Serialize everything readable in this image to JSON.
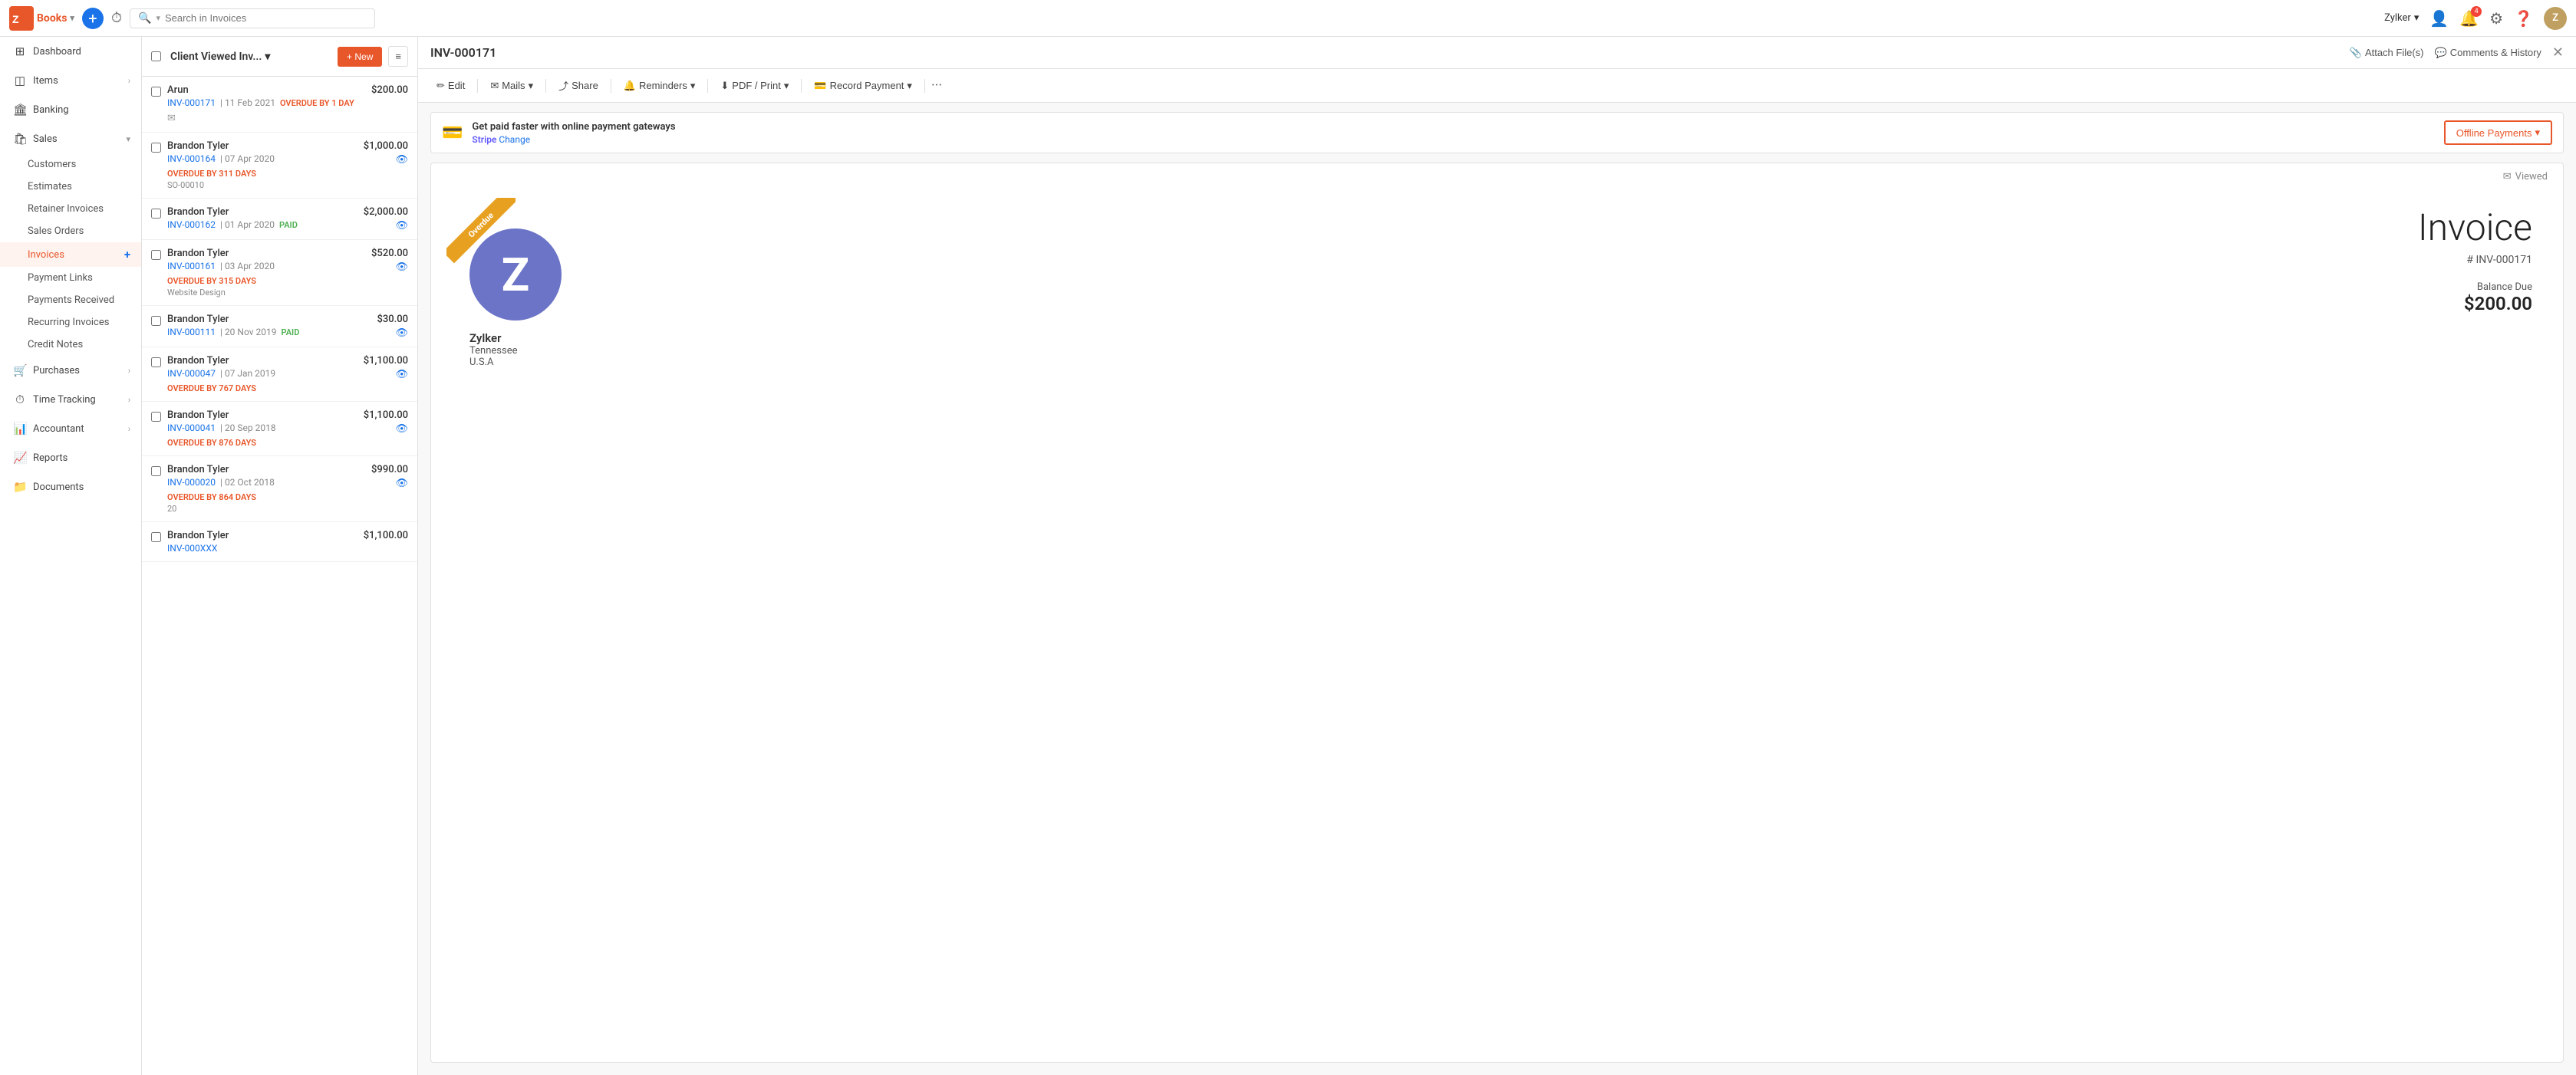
{
  "app": {
    "logo_text": "Books",
    "logo_dropdown": "▾"
  },
  "topnav": {
    "search_placeholder": "Search in Invoices",
    "user_name": "Zylker",
    "user_dropdown": "▾",
    "notification_count": "4"
  },
  "sidebar": {
    "items": [
      {
        "id": "dashboard",
        "label": "Dashboard",
        "icon": "⊞",
        "has_arrow": false
      },
      {
        "id": "items",
        "label": "Items",
        "icon": "◫",
        "has_arrow": true
      },
      {
        "id": "banking",
        "label": "Banking",
        "icon": "🏦",
        "has_arrow": false
      }
    ],
    "sales": {
      "label": "Sales",
      "sub_items": [
        {
          "id": "customers",
          "label": "Customers"
        },
        {
          "id": "estimates",
          "label": "Estimates"
        },
        {
          "id": "retainer-invoices",
          "label": "Retainer Invoices"
        },
        {
          "id": "sales-orders",
          "label": "Sales Orders"
        },
        {
          "id": "invoices",
          "label": "Invoices",
          "active": true,
          "has_plus": true
        },
        {
          "id": "payment-links",
          "label": "Payment Links"
        },
        {
          "id": "payments-received",
          "label": "Payments Received"
        },
        {
          "id": "recurring-invoices",
          "label": "Recurring Invoices"
        },
        {
          "id": "credit-notes",
          "label": "Credit Notes"
        }
      ]
    },
    "other_items": [
      {
        "id": "purchases",
        "label": "Purchases",
        "icon": "🛒",
        "has_arrow": true
      },
      {
        "id": "time-tracking",
        "label": "Time Tracking",
        "icon": "⏱",
        "has_arrow": true
      },
      {
        "id": "accountant",
        "label": "Accountant",
        "icon": "📊",
        "has_arrow": true
      },
      {
        "id": "reports",
        "label": "Reports",
        "icon": "📈",
        "has_arrow": false
      },
      {
        "id": "documents",
        "label": "Documents",
        "icon": "📁",
        "has_arrow": false
      }
    ]
  },
  "invoice_list": {
    "title": "Client Viewed Inv...",
    "new_btn_label": "+ New",
    "invoices": [
      {
        "customer": "Arun",
        "number": "INV-000171",
        "date": "11 Feb 2021",
        "amount": "$200.00",
        "status": "OVERDUE BY 1 DAY",
        "status_type": "overdue",
        "ref": "",
        "has_mail": true,
        "has_eye": false
      },
      {
        "customer": "Brandon Tyler",
        "number": "INV-000164",
        "date": "07 Apr 2020",
        "amount": "$1,000.00",
        "status": "OVERDUE BY 311 DAYS",
        "status_type": "overdue",
        "ref": "SO-00010",
        "has_mail": false,
        "has_eye": true
      },
      {
        "customer": "Brandon Tyler",
        "number": "INV-000162",
        "date": "01 Apr 2020",
        "amount": "$2,000.00",
        "status": "PAID",
        "status_type": "paid",
        "ref": "",
        "has_mail": false,
        "has_eye": true
      },
      {
        "customer": "Brandon Tyler",
        "number": "INV-000161",
        "date": "03 Apr 2020",
        "amount": "$520.00",
        "status": "OVERDUE BY 315 DAYS",
        "status_type": "overdue",
        "ref": "Website Design",
        "has_mail": false,
        "has_eye": true
      },
      {
        "customer": "Brandon Tyler",
        "number": "INV-000111",
        "date": "20 Nov 2019",
        "amount": "$30.00",
        "status": "PAID",
        "status_type": "paid",
        "ref": "",
        "has_mail": false,
        "has_eye": true
      },
      {
        "customer": "Brandon Tyler",
        "number": "INV-000047",
        "date": "07 Jan 2019",
        "amount": "$1,100.00",
        "status": "OVERDUE BY 767 DAYS",
        "status_type": "overdue",
        "ref": "",
        "has_mail": false,
        "has_eye": true
      },
      {
        "customer": "Brandon Tyler",
        "number": "INV-000041",
        "date": "20 Sep 2018",
        "amount": "$1,100.00",
        "status": "OVERDUE BY 876 DAYS",
        "status_type": "overdue",
        "ref": "",
        "has_mail": false,
        "has_eye": true
      },
      {
        "customer": "Brandon Tyler",
        "number": "INV-000020",
        "date": "02 Oct 2018",
        "amount": "$990.00",
        "status": "OVERDUE BY 864 DAYS",
        "status_type": "overdue",
        "ref": "20",
        "has_mail": false,
        "has_eye": true
      },
      {
        "customer": "Brandon Tyler",
        "number": "INV-000XXX",
        "date": "",
        "amount": "$1,100.00",
        "status": "",
        "status_type": "",
        "ref": "",
        "has_mail": false,
        "has_eye": false
      }
    ]
  },
  "invoice_detail": {
    "invoice_id": "INV-000171",
    "attach_label": "Attach File(s)",
    "comments_label": "Comments & History",
    "toolbar": {
      "edit": "Edit",
      "mails": "Mails",
      "share": "Share",
      "reminders": "Reminders",
      "pdf_print": "PDF / Print",
      "record_payment": "Record Payment",
      "more": "···"
    },
    "banner": {
      "title": "Get paid faster with online payment gateways",
      "stripe_label": "Stripe",
      "change_label": "Change",
      "offline_btn": "Offline Payments",
      "offline_btn_dropdown": "▾"
    },
    "viewed_label": "Viewed",
    "overdue_ribbon": "Overdue",
    "company_initial": "Z",
    "company_name": "Zylker",
    "company_city": "Tennessee",
    "company_country": "U.S.A",
    "invoice_heading": "Invoice",
    "invoice_hash_number": "# INV-000171",
    "balance_due_label": "Balance Due",
    "balance_due_amount": "$200.00"
  }
}
